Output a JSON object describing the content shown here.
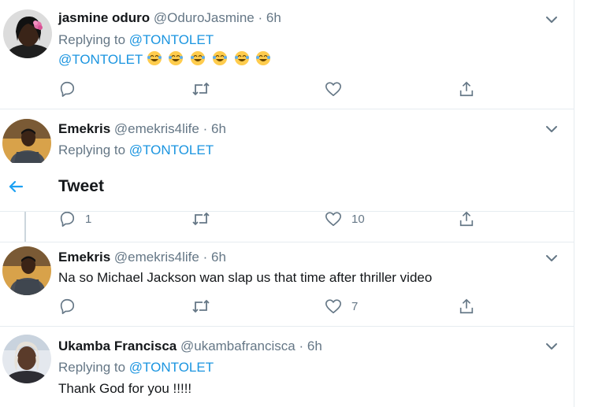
{
  "tweets": [
    {
      "name": "jasmine oduro",
      "handle": "@OduroJasmine",
      "dot": "·",
      "time": "6h",
      "reply_prefix": "Replying to",
      "reply_to": "@TONTOLET",
      "text_mention": "@TONTOLET",
      "emoji_count": 6,
      "actions": {
        "reply": "",
        "retweet": "",
        "like": ""
      }
    },
    {
      "name": "Emekris",
      "handle": "@emekris4life",
      "dot": "·",
      "time": "6h",
      "reply_prefix": "Replying to",
      "reply_to": "@TONTOLET",
      "actions": {
        "reply": "1",
        "retweet": "",
        "like": "10"
      }
    },
    {
      "name": "Emekris",
      "handle": "@emekris4life",
      "dot": "·",
      "time": "6h",
      "text": "Na so Michael Jackson wan slap us that time after thriller video",
      "actions": {
        "reply": "",
        "retweet": "",
        "like": "7"
      }
    },
    {
      "name": "Ukamba Francisca",
      "handle": "@ukambafrancisca",
      "dot": "·",
      "time": "6h",
      "reply_prefix": "Replying to",
      "reply_to": "@TONTOLET",
      "text": "Thank God for you !!!!!"
    }
  ],
  "header": {
    "title": "Tweet"
  },
  "colors": {
    "link": "#1b95e0",
    "muted": "#657786",
    "text": "#14171a",
    "divider": "#e6ecf0"
  }
}
